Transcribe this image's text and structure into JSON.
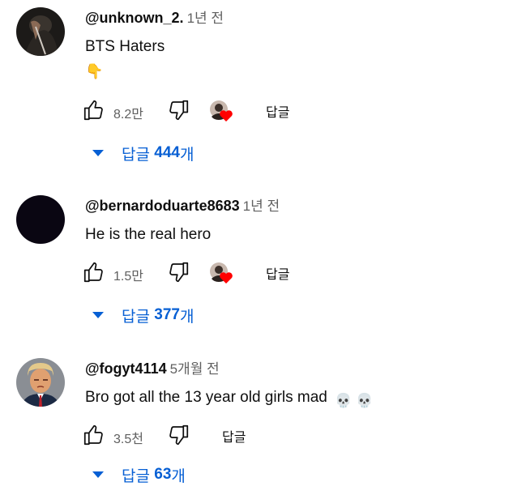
{
  "comments": [
    {
      "author": "@unknown_2.",
      "time": "1년 전",
      "text": "BTS Haters",
      "emoji_line": "👇",
      "likes": "8.2만",
      "reply_label": "답글",
      "replies_prefix": "답글",
      "replies_count": "444",
      "replies_suffix": "개",
      "creator_heart": true
    },
    {
      "author": "@bernardoduarte8683",
      "time": "1년 전",
      "text": "He is the real hero",
      "likes": "1.5만",
      "reply_label": "답글",
      "replies_prefix": "답글",
      "replies_count": "377",
      "replies_suffix": "개",
      "creator_heart": true
    },
    {
      "author": "@fogyt4114",
      "time": "5개월 전",
      "text": "Bro got all the 13 year old girls mad",
      "text_emojis": "💀 💀",
      "likes": "3.5천",
      "reply_label": "답글",
      "replies_prefix": "답글",
      "replies_count": "63",
      "replies_suffix": "개",
      "creator_heart": false
    }
  ],
  "icons": {
    "like": "thumb-up-icon",
    "dislike": "thumb-down-icon",
    "heart": "creator-heart-icon",
    "caret": "caret-down-icon"
  },
  "colors": {
    "link_blue": "#065fd4",
    "meta_gray": "#606060",
    "heart_red": "#ff0000"
  }
}
